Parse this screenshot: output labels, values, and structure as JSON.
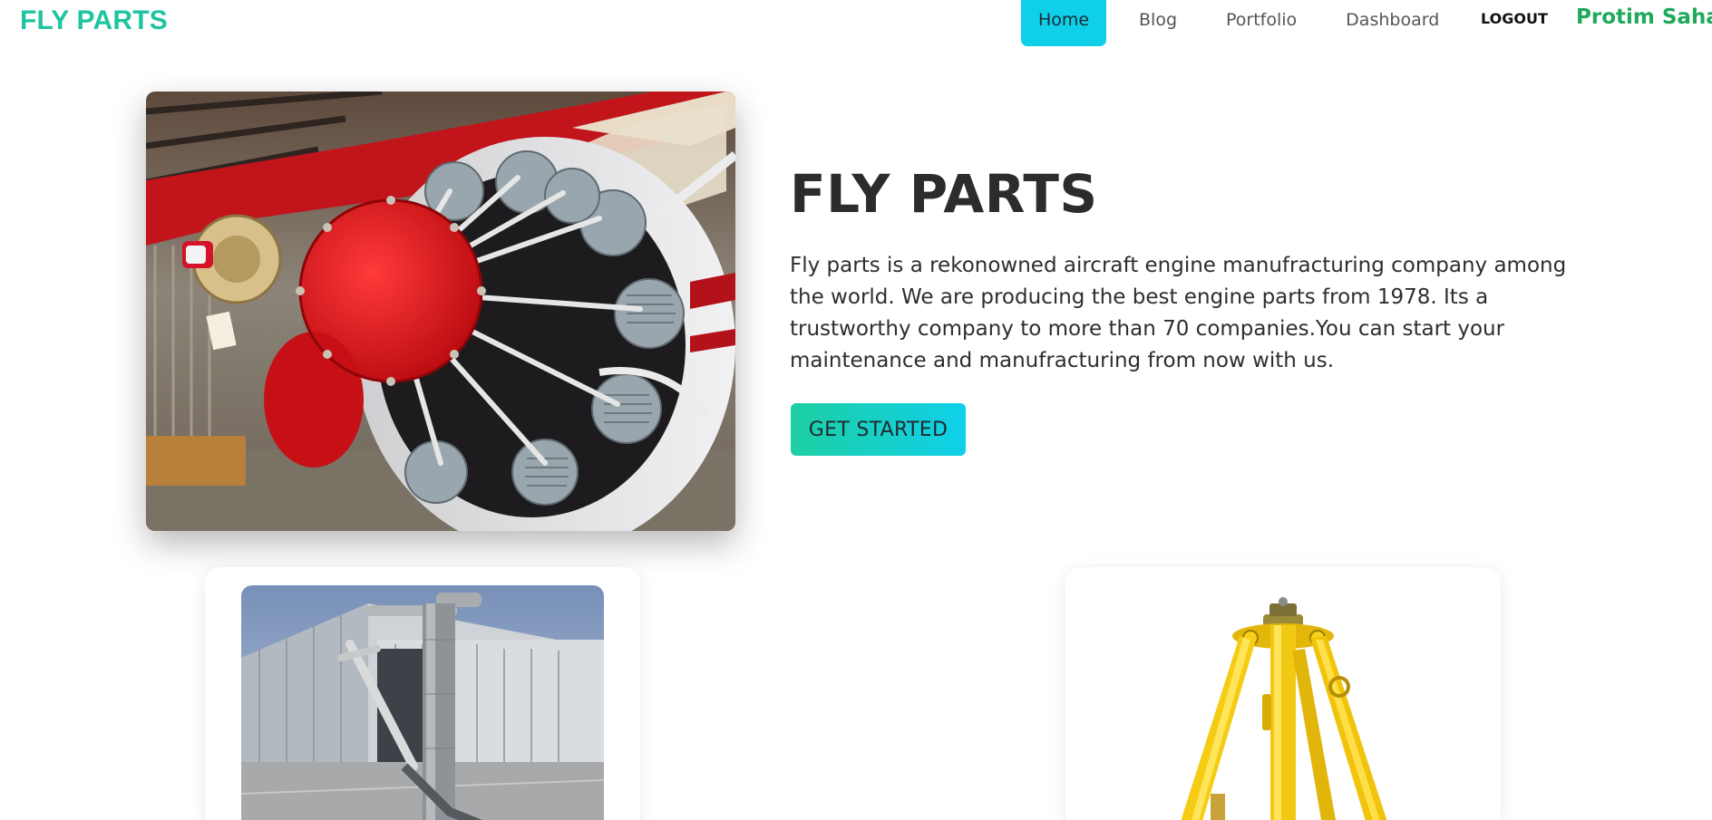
{
  "navbar": {
    "brand": "FLY PARTS",
    "links": [
      {
        "label": "Home",
        "active": true
      },
      {
        "label": "Blog",
        "active": false
      },
      {
        "label": "Portfolio",
        "active": false
      },
      {
        "label": "Dashboard",
        "active": false
      }
    ],
    "logout_label": "LOGOUT",
    "user_name": "Protim Saha"
  },
  "hero": {
    "title": "FLY PARTS",
    "description": "Fly parts is a rekonowned aircraft engine manufracturing company among the world. We are producing the best engine parts from 1978. Its a trustworthy company to more than 70 companies.You can start your maintenance and manufracturing from now with us.",
    "cta_label": "GET STARTED",
    "image": "radial aircraft engine photo"
  },
  "products": [
    {
      "image": "hangar with gray aircraft tool stand photo"
    },
    {
      "image": "yellow tripod aircraft jack photo"
    }
  ],
  "colors": {
    "brand": "#1fc4a0",
    "active_nav": "#0fcfe9",
    "user_name": "#1faa5b",
    "cta_gradient_start": "#1ecfa4",
    "cta_gradient_end": "#0fd0ea"
  }
}
